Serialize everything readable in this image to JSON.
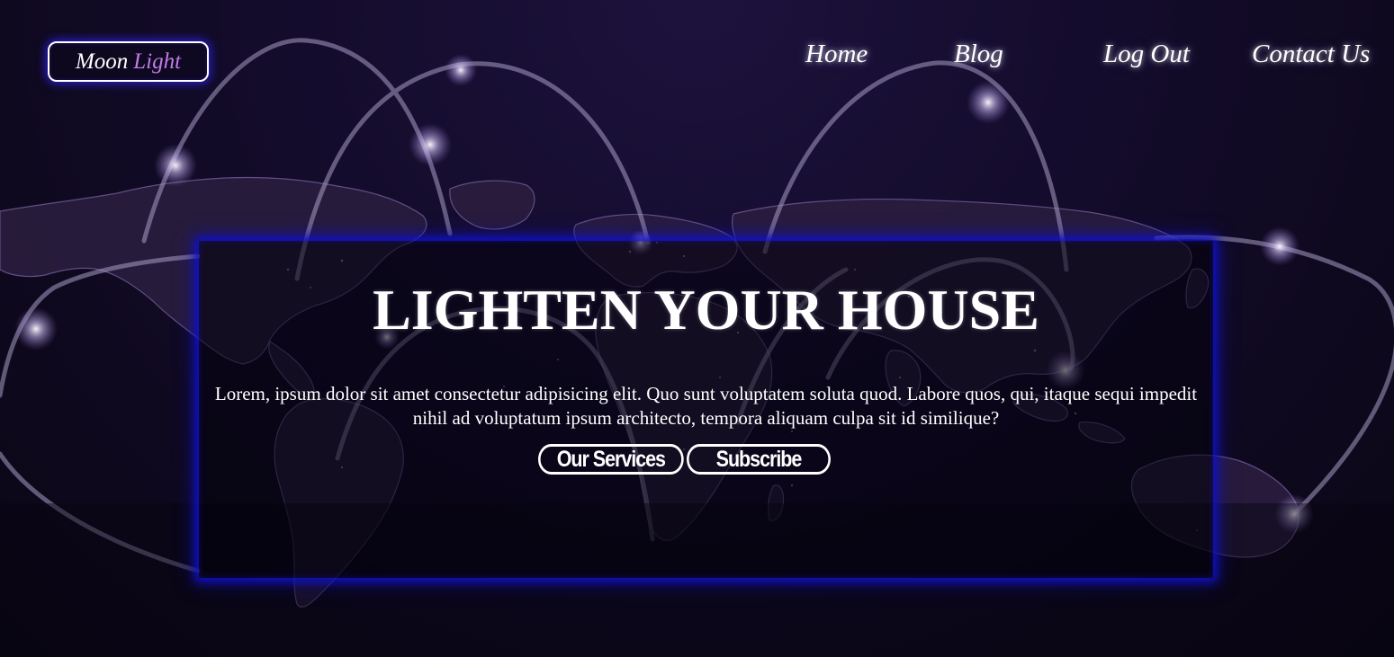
{
  "logo": {
    "part1": "Moon",
    "part2": "Light",
    "accent_color": "#c07ce6"
  },
  "nav": {
    "items": [
      {
        "label": "Home"
      },
      {
        "label": "Blog"
      },
      {
        "label": "Log Out"
      },
      {
        "label": "Contact Us"
      }
    ]
  },
  "hero": {
    "title": "LIGHTEN YOUR HOUSE",
    "description": "Lorem, ipsum dolor sit amet consectetur adipisicing elit. Quo sunt voluptatem soluta quod. Labore quos, qui, itaque sequi impedit nihil ad voluptatum ipsum architecto, tempora aliquam culpa sit id similique?",
    "buttons": {
      "services": "Our Services",
      "subscribe": "Subscribe"
    },
    "glow_color": "#1010c8"
  },
  "background": {
    "image": "world-map-connections",
    "base_color": "#140c2c"
  }
}
